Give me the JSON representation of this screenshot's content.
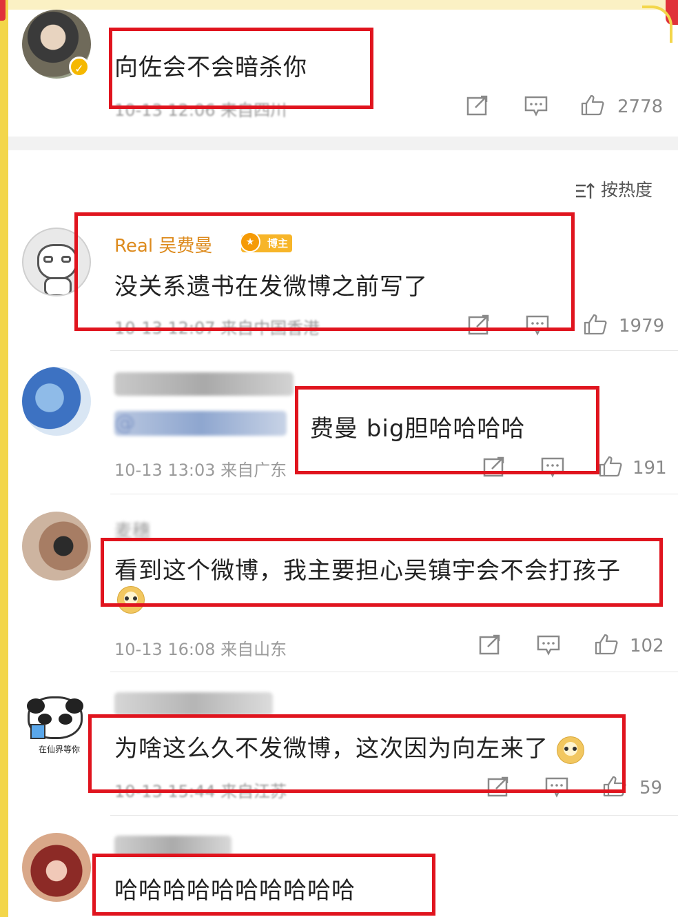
{
  "sort_label": "按热度",
  "comments": [
    {
      "username": "",
      "text": "向佐会不会暗杀你",
      "meta": "10-13 12:06 来自四川",
      "likes": "2778"
    },
    {
      "username": "Real 吴费曼",
      "badge": "博主",
      "text": "没关系遗书在发微博之前写了",
      "meta": "10-13 12:07 来自中国香港",
      "likes": "1979"
    },
    {
      "username": "",
      "mention": "@",
      "text": "费曼 big胆哈哈哈哈",
      "meta": "10-13 13:03 来自广东",
      "likes": "191"
    },
    {
      "username": "麦穗",
      "text": "看到这个微博，我主要担心吴镇宇会不会打孩子",
      "meta": "10-13 16:08 来自山东",
      "likes": "102"
    },
    {
      "username": "",
      "avatar_caption": "在仙界等你",
      "text": "为啥这么久不发微博，这次因为向左来了",
      "meta": "10-13 15:44 来自江苏",
      "likes": "59"
    },
    {
      "username": "",
      "text": "哈哈哈哈哈哈哈哈哈哈"
    }
  ],
  "icons": {
    "share": "share-icon",
    "comment": "comment-icon",
    "like": "like-icon",
    "sort": "sort-icon",
    "verified": "verified-icon"
  },
  "colors": {
    "highlight": "#e0141e",
    "username": "#dd8b1e",
    "meta": "#9b9b9b",
    "frame": "#f3d64a"
  }
}
